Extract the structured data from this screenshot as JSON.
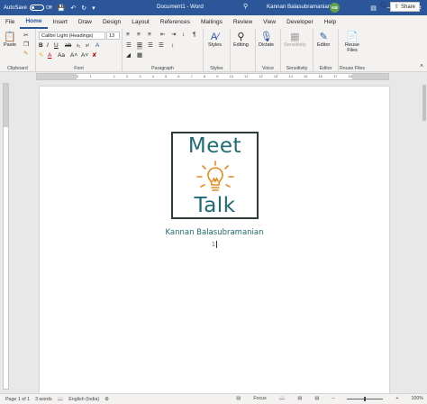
{
  "titlebar": {
    "autosave_label": "AutoSave",
    "autosave_state": "Off",
    "doc_title": "Document1  -  Word",
    "user_name": "Kannan Balasubramanian",
    "avatar_initials": "KB",
    "accent_color": "#2b579a"
  },
  "tabs": [
    "File",
    "Home",
    "Insert",
    "Draw",
    "Design",
    "Layout",
    "References",
    "Mailings",
    "Review",
    "View",
    "Developer",
    "Help"
  ],
  "active_tab": "Home",
  "share_label": "Share",
  "ribbon": {
    "clipboard": {
      "paste": "Paste",
      "label": "Clipboard"
    },
    "font": {
      "family": "Calibri Light (Headings)",
      "size": "13",
      "label": "Font"
    },
    "paragraph": {
      "label": "Paragraph"
    },
    "styles": {
      "button": "Styles",
      "label": "Styles"
    },
    "editing": {
      "button": "Editing"
    },
    "voice": {
      "dictate": "Dictate",
      "label": "Voice"
    },
    "sensitivity": {
      "button": "Sensitivity",
      "label": "Sensitivity"
    },
    "editor": {
      "button": "Editor",
      "label": "Editor"
    },
    "reuse": {
      "button": "Reuse Files",
      "label": "Reuse Files"
    }
  },
  "ruler_numbers": [
    "2",
    "1",
    "",
    "1",
    "2",
    "3",
    "4",
    "5",
    "6",
    "7",
    "8",
    "9",
    "10",
    "11",
    "12",
    "13",
    "14",
    "15",
    "16",
    "17",
    "18"
  ],
  "document": {
    "logo_top": "Meet",
    "logo_bottom": "Talk",
    "author": "Kannan Balasubramanian",
    "page_number": "1",
    "logo_text_color": "#1f6b73",
    "bulb_color": "#e8891c"
  },
  "status": {
    "page": "Page 1 of 1",
    "words": "3 words",
    "language": "English (India)",
    "focus": "Focus",
    "zoom": "100%"
  }
}
